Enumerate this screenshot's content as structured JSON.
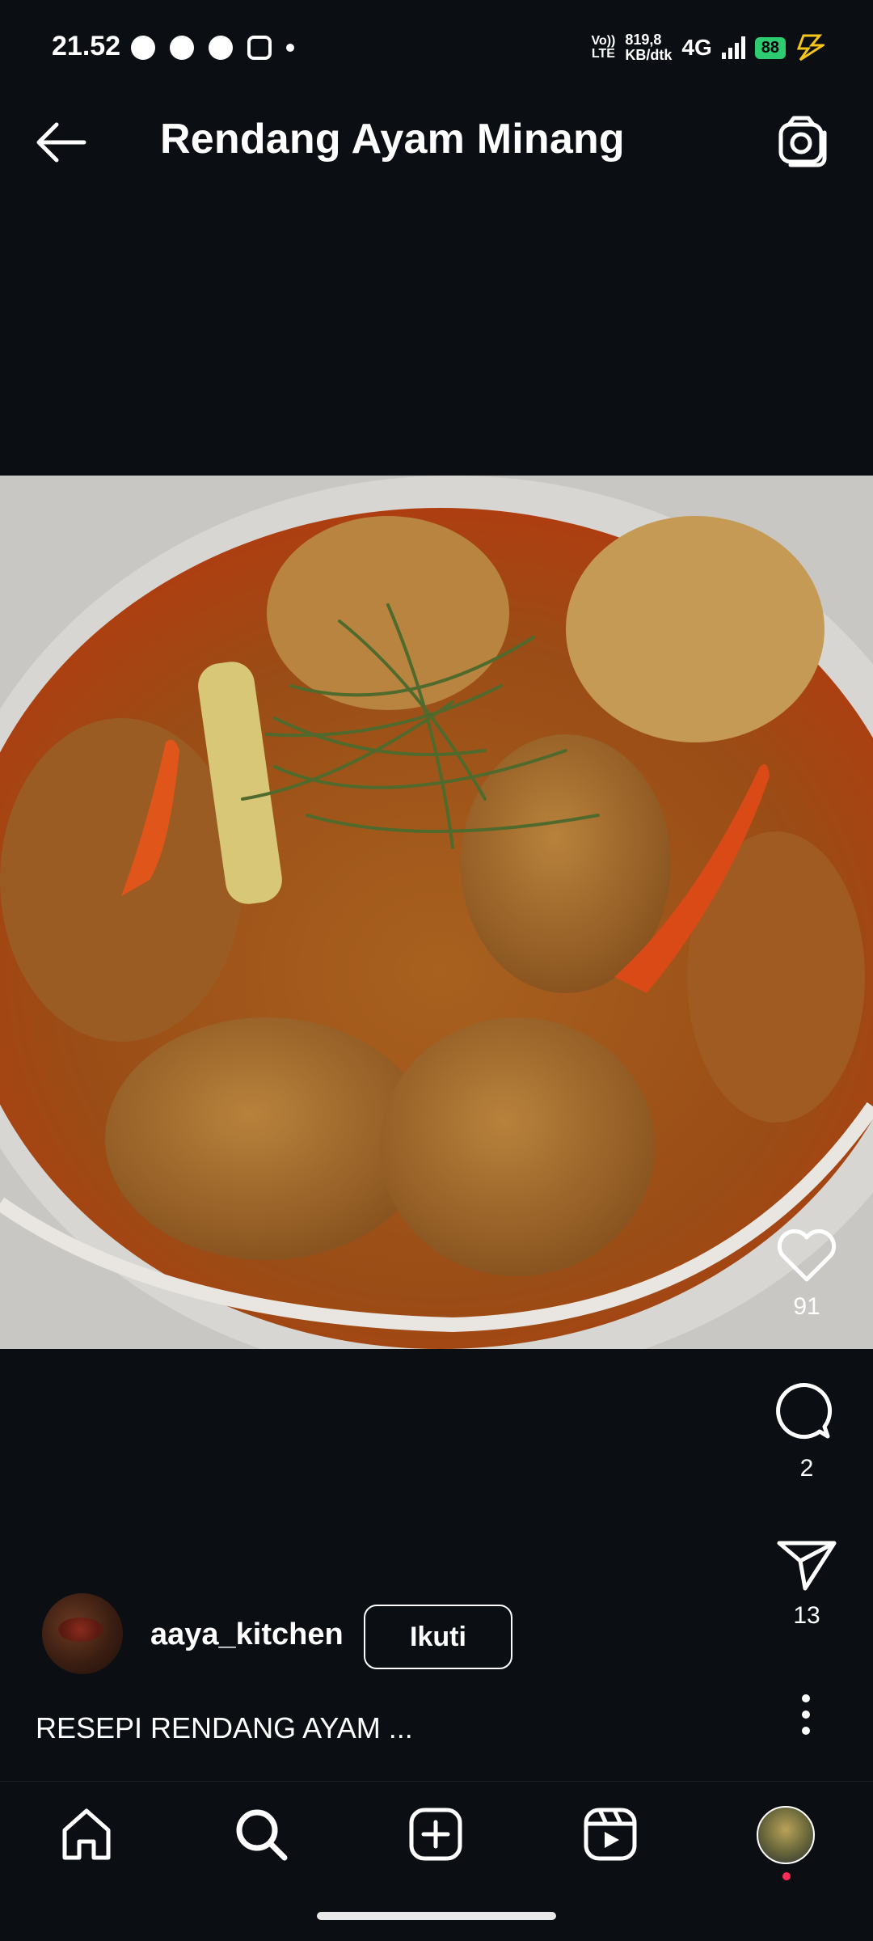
{
  "status_bar": {
    "time": "21.52",
    "app_icons": [
      "whatsapp-icon",
      "facebook-icon",
      "facebook-icon",
      "instagram-icon",
      "dot-icon"
    ],
    "volte_top": "Vo))",
    "volte_bottom": "LTE",
    "speed_top": "819,8",
    "speed_bottom": "KB/dtk",
    "network": "4G",
    "battery": "88",
    "colors": {
      "battery": "#2ecc71",
      "bolt": "#f5c518"
    }
  },
  "header": {
    "title": "Rendang Ayam Minang",
    "back_icon": "arrow-left-icon",
    "camera_icon": "camera-icon"
  },
  "actions": {
    "like_count": "91",
    "comment_count": "2",
    "share_count": "13"
  },
  "author": {
    "username": "aaya_kitchen",
    "follow_label": "Ikuti"
  },
  "caption": "RESEPI RENDANG AYAM ...",
  "bottom_nav": {
    "items": [
      "home-icon",
      "search-icon",
      "add-post-icon",
      "reels-icon",
      "profile-avatar"
    ]
  }
}
